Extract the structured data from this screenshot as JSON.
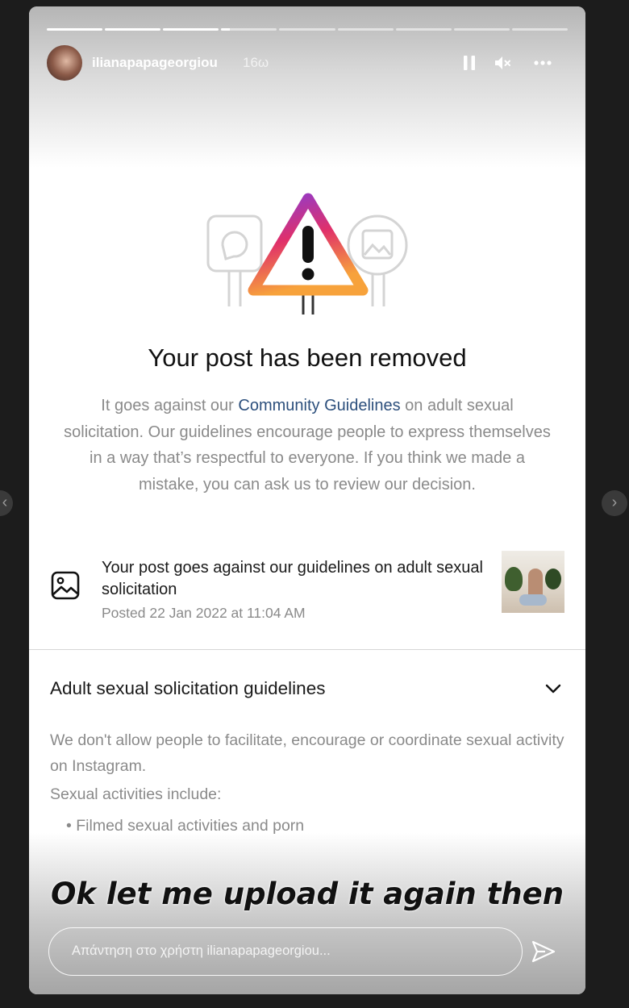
{
  "story": {
    "username": "ilianapapageorgiou",
    "time_ago": "16ω",
    "progress": {
      "segments": 9,
      "current_index": 3,
      "current_fraction": 0.15
    }
  },
  "icons": {
    "pause": "pause-icon",
    "mute": "speaker-muted-icon",
    "more": "more-horizontal-icon",
    "warning": "warning-triangle-icon",
    "post": "image-icon",
    "chevron": "chevron-down-icon",
    "send": "paper-plane-icon",
    "nav_prev": "chevron-left-icon",
    "nav_next": "chevron-right-icon"
  },
  "notice": {
    "title": "Your post has been removed",
    "desc_before": "It goes against our ",
    "desc_link": "Community Guidelines",
    "desc_after": " on adult sexual solicitation. Our guidelines encourage people to express themselves in a way that’s respectful to everyone. If you think we made a mistake, you can ask us to review our decision."
  },
  "post": {
    "title": "Your post goes against our guidelines on adult sexual solicitation",
    "date": "Posted 22 Jan 2022 at 11:04 AM"
  },
  "guidelines": {
    "title": "Adult sexual solicitation guidelines",
    "text": "We don't allow people to facilitate, encourage or coordinate sexual activity on Instagram.",
    "activities_label": "Sexual activities include:",
    "item_1": "• Filmed sexual activities and porn"
  },
  "overlay": {
    "text": "Ok let me upload it again then"
  },
  "reply": {
    "placeholder": "Απάντηση στο χρήστη ilianapapageorgiou..."
  },
  "colors": {
    "link": "#2c4f7c",
    "warning_gradient": [
      "#8e3bcf",
      "#e0306a",
      "#f7a23b"
    ]
  }
}
